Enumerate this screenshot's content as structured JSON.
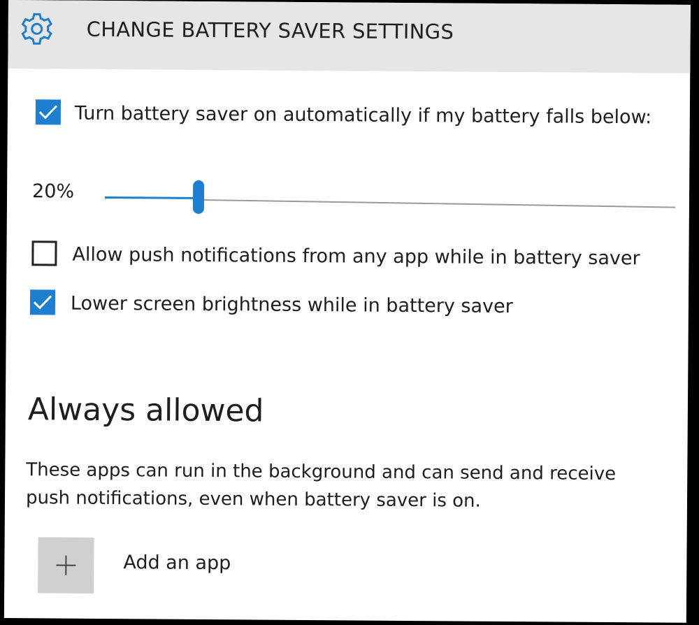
{
  "header": {
    "title": "CHANGE BATTERY SAVER SETTINGS",
    "icon": "gear-icon"
  },
  "options": {
    "auto_on": {
      "checked": true,
      "label_plain": "Turn battery saver on automatically if my battery falls below:"
    },
    "threshold": {
      "value_text": "20%",
      "value": 20
    },
    "push_notifications": {
      "checked": false,
      "label": "Allow push notifications from any app while in battery saver"
    },
    "lower_brightness": {
      "checked": true,
      "label": "Lower screen brightness while in battery saver"
    }
  },
  "always_allowed": {
    "heading": "Always allowed",
    "description": "These apps can run in the background and can send and receive push notifications, even when battery saver is on.",
    "add_app_label": "Add an app",
    "add_icon": "plus-icon"
  },
  "colors": {
    "accent": "#1e7fd0",
    "header_bg": "#e6e6e6"
  }
}
